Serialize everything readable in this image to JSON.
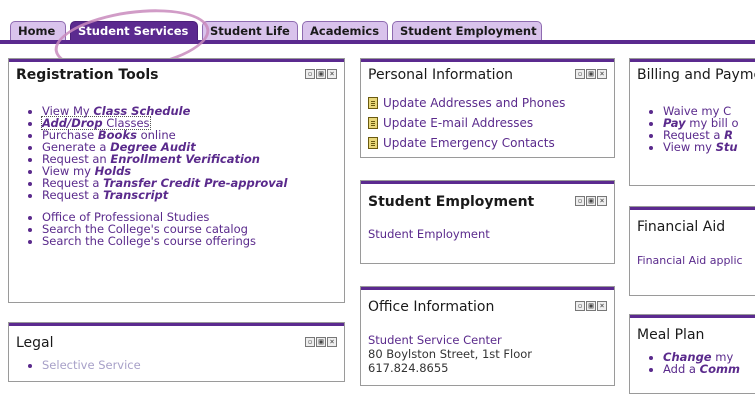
{
  "tabs": [
    {
      "label": "Home"
    },
    {
      "label": "Student Services"
    },
    {
      "label": "Student Life"
    },
    {
      "label": "Academics"
    },
    {
      "label": "Student Employment"
    }
  ],
  "registration": {
    "title": "Registration Tools",
    "links1": [
      {
        "pre": "View My ",
        "em": "Class Schedule",
        "post": ""
      },
      {
        "pre": "",
        "em": "Add/Drop",
        "post": " Classes"
      },
      {
        "pre": "Purchase ",
        "em": "Books",
        "post": " online"
      },
      {
        "pre": "Generate a ",
        "em": "Degree Audit",
        "post": ""
      },
      {
        "pre": "Request an ",
        "em": "Enrollment Verification",
        "post": ""
      },
      {
        "pre": "View my ",
        "em": "Holds",
        "post": ""
      },
      {
        "pre": "Request a ",
        "em": "Transfer Credit Pre-approval",
        "post": ""
      },
      {
        "pre": "Request a ",
        "em": "Transcript",
        "post": ""
      }
    ],
    "links2": [
      "Office of Professional Studies",
      "Search the College's course catalog",
      "Search the College's course offerings"
    ]
  },
  "personal": {
    "title": "Personal Information",
    "links": [
      "Update Addresses and Phones",
      "Update E-mail Addresses",
      "Update Emergency Contacts"
    ]
  },
  "employment": {
    "title": "Student Employment",
    "link": "Student Employment"
  },
  "office": {
    "title": "Office Information",
    "link": "Student Service Center",
    "address": "80 Boylston Street, 1st Floor",
    "phone": "617.824.8655"
  },
  "legal": {
    "title": "Legal",
    "link": "Selective Service"
  },
  "billing": {
    "title": "Billing and Payments",
    "items": [
      {
        "pre": "Waive my C",
        "em": ""
      },
      {
        "pre": "",
        "em": "Pay",
        "post": " my bill o"
      },
      {
        "pre": "Request a ",
        "em": "R"
      },
      {
        "pre": "View my ",
        "em": "Stu"
      }
    ]
  },
  "financial": {
    "title": "Financial Aid",
    "link": "Financial Aid applic"
  },
  "meal": {
    "title": "Meal Plan",
    "items": [
      {
        "pre": "",
        "em": "Change",
        "post": " my"
      },
      {
        "pre": "Add a ",
        "em": "Comm",
        "post": ""
      }
    ]
  }
}
